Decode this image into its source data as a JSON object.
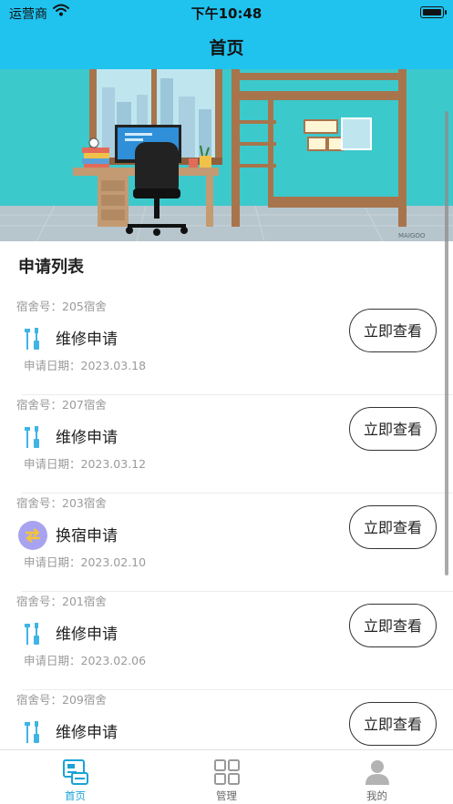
{
  "status_bar": {
    "carrier": "运营商",
    "time": "下午10:48"
  },
  "nav": {
    "title": "首页"
  },
  "banner": {
    "watermark": "MAIGOO"
  },
  "list": {
    "title": "申请列表",
    "items": [
      {
        "dorm": "宿舍号：205宿舍",
        "type": "维修申请",
        "icon": "wrench-screwdriver-icon",
        "date": "申请日期：2023.03.18",
        "button": "立即查看"
      },
      {
        "dorm": "宿舍号：207宿舍",
        "type": "维修申请",
        "icon": "wrench-screwdriver-icon",
        "date": "申请日期：2023.03.12",
        "button": "立即查看"
      },
      {
        "dorm": "宿舍号：203宿舍",
        "type": "换宿申请",
        "icon": "swap-arrows-icon",
        "date": "申请日期：2023.02.10",
        "button": "立即查看"
      },
      {
        "dorm": "宿舍号：201宿舍",
        "type": "维修申请",
        "icon": "wrench-screwdriver-icon",
        "date": "申请日期：2023.02.06",
        "button": "立即查看"
      },
      {
        "dorm": "宿舍号：209宿舍",
        "type": "维修申请",
        "icon": "wrench-screwdriver-icon",
        "date": "",
        "button": "立即查看"
      }
    ]
  },
  "tabbar": {
    "tabs": [
      {
        "label": "首页",
        "active": true
      },
      {
        "label": "管理",
        "active": false
      },
      {
        "label": "我的",
        "active": false
      }
    ]
  },
  "colors": {
    "header": "#20c2ee",
    "tab_active": "#1aa2d6",
    "repair_icon": "#3fb4e6",
    "swap_icon_bg": "#a8a3f0",
    "swap_icon_fg": "#f3c437"
  }
}
